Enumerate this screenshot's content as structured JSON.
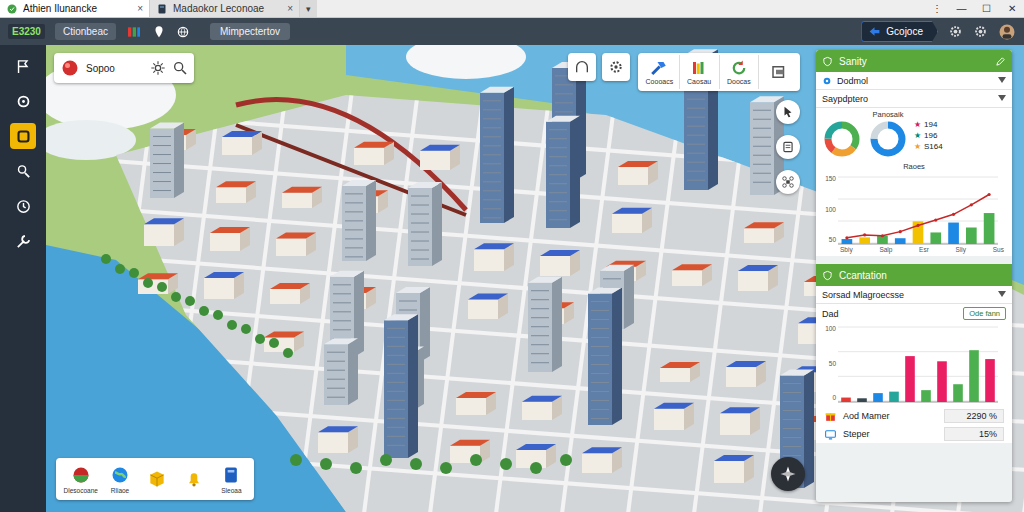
{
  "window": {
    "tabs": [
      {
        "label": "Athien Ilunancke",
        "close": "×",
        "selected": true
      },
      {
        "label": "Madaokor Leconoae",
        "close": "×",
        "selected": false
      }
    ],
    "tab_menu": "▾",
    "controls": [
      "⋮",
      "—",
      "☐",
      "✕"
    ]
  },
  "toolbar": {
    "logo": "E3230",
    "menu": "Ctionbeac",
    "button": "Mimpectertov",
    "action": "Gcojoce"
  },
  "sidebar": {
    "items": [
      {
        "selected": false
      },
      {
        "selected": false
      },
      {
        "selected": true
      },
      {
        "selected": false
      },
      {
        "selected": false
      },
      {
        "selected": false
      }
    ]
  },
  "map": {
    "search": {
      "label": "Sopoo"
    },
    "tool_group": {
      "labels": [
        "Coooacs",
        "Caosau",
        "Doocas"
      ]
    },
    "bottom_tools": {
      "labels": [
        "Dlesocoane",
        "Rliaoe",
        "Sleoaa"
      ]
    }
  },
  "panel": {
    "stats": {
      "title": "Sanity",
      "dropdown": "Dodmol",
      "subtitle": "Saypdptero",
      "caption": "Panosaik",
      "donut_label": "Raoes",
      "legend": [
        {
          "mark": "★",
          "value": "194",
          "color": "#d81b60"
        },
        {
          "mark": "★",
          "value": "196",
          "color": "#00897b"
        },
        {
          "mark": "★",
          "value": "S164",
          "color": "#f0a030"
        }
      ],
      "donuts": [
        {
          "segments": [
            {
              "value": 35,
              "color": "#4caf50"
            },
            {
              "value": 25,
              "color": "#f0a030"
            },
            {
              "value": 15,
              "color": "#e74c3c"
            },
            {
              "value": 25,
              "color": "#26a69a"
            }
          ]
        },
        {
          "segments": [
            {
              "value": 75,
              "color": "#1e88e5"
            },
            {
              "value": 25,
              "color": "#cfd8dc"
            }
          ]
        }
      ],
      "chart": {
        "y_ticks": [
          "150",
          "100",
          "50"
        ],
        "x_labels": [
          "Sbiy",
          "Salp",
          "Esr",
          "Sliy",
          "Sus"
        ],
        "max": 160,
        "bars": {
          "values": [
            12,
            16,
            20,
            14,
            55,
            28,
            52,
            40,
            75
          ],
          "colors": [
            "#1e88e5",
            "#f2c200",
            "#4caf50",
            "#1e88e5",
            "#f2c200",
            "#4caf50",
            "#1e88e5",
            "#4caf50",
            "#4caf50"
          ]
        },
        "line": [
          15,
          22,
          20,
          30,
          45,
          58,
          72,
          95,
          120
        ]
      }
    },
    "consultation": {
      "title": "Ccantation",
      "dropdown": "Sorsad Mlagroecsse",
      "label": "Dad",
      "badge": "Ode fann",
      "chart": {
        "y_ticks": [
          "100",
          "50",
          "0"
        ],
        "max": 100,
        "bars": {
          "values": [
            6,
            5,
            12,
            14,
            62,
            16,
            55,
            24,
            70,
            58
          ],
          "colors": [
            "#e53935",
            "#37474f",
            "#1e88e5",
            "#26a69a",
            "#e91e63",
            "#4caf50",
            "#e91e63",
            "#4caf50",
            "#4caf50",
            "#e91e63"
          ]
        }
      },
      "rows": [
        {
          "label": "Aod Mamer",
          "value": "2290 %"
        },
        {
          "label": "Steper",
          "value": "15%"
        }
      ]
    }
  }
}
